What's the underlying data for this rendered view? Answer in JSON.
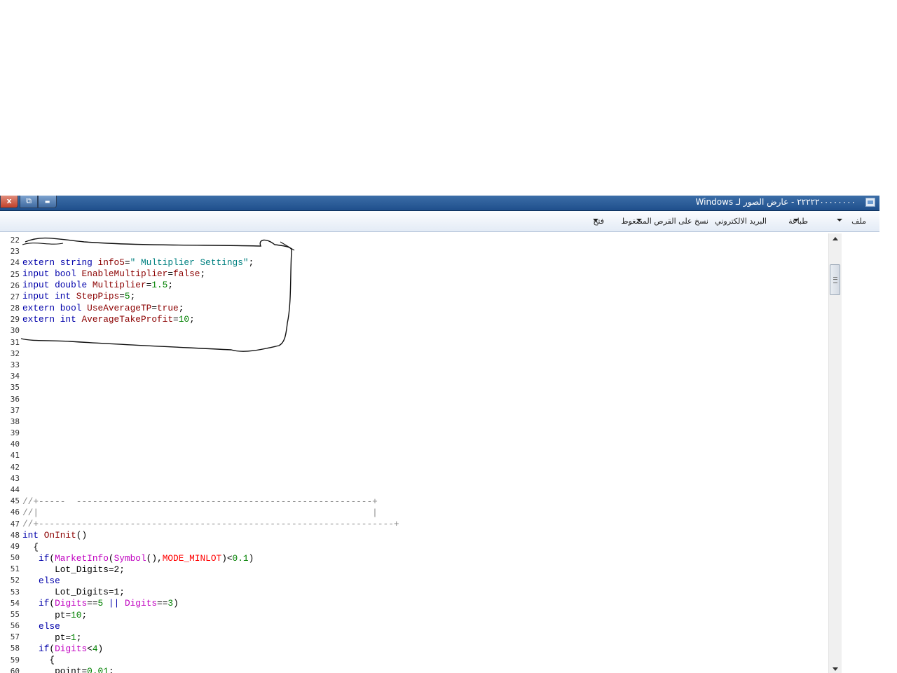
{
  "window": {
    "title": "٢٢٢٢٢٠٠٠٠٠٠٠٠ - عارض الصور لـ Windows",
    "close_glyph": "x",
    "maximize_glyph": "⧉",
    "minimize_glyph": "▬"
  },
  "menu": {
    "file": "ملف",
    "print": "طباعة",
    "email": "البريد الالكتروني",
    "burn": "نسخ على القرص المضغوط",
    "open": "فتح"
  },
  "code": {
    "line_numbers": [
      "22",
      "23",
      "24",
      "25",
      "26",
      "27",
      "28",
      "29",
      "30",
      "31",
      "32",
      "33",
      "34",
      "35",
      "36",
      "37",
      "38",
      "39",
      "40",
      "41",
      "42",
      "43",
      "44",
      "45",
      "46",
      "47",
      "48",
      "49",
      "50",
      "51",
      "52",
      "53",
      "54",
      "55",
      "56",
      "57",
      "58",
      "59",
      "60"
    ],
    "l24": {
      "kw": "extern string ",
      "var": "info5",
      "eq": "=",
      "str": "\" Multiplier Settings\"",
      "end": ";"
    },
    "l25": {
      "kw": "input bool ",
      "var": "EnableMultiplier",
      "eq": "=",
      "val": "false",
      "end": ";"
    },
    "l26": {
      "kw": "input double ",
      "var": "Multiplier",
      "eq": "=",
      "val": "1.5",
      "end": ";"
    },
    "l27": {
      "kw": "input int ",
      "var": "StepPips",
      "eq": "=",
      "val": "5",
      "end": ";"
    },
    "l28": {
      "kw": "extern bool ",
      "var": "UseAverageTP",
      "eq": "=",
      "val": "true",
      "end": ";"
    },
    "l29": {
      "kw": "extern int ",
      "var": "AverageTakeProfit",
      "eq": "=",
      "val": "10",
      "end": ";"
    },
    "l45": "//+-----  -------------------------------------------------------+",
    "l46": "//|                                                              |",
    "l47": "//+------------------------------------------------------------------+",
    "l48": {
      "kw": "int ",
      "fn": "OnInit",
      "rest": "()"
    },
    "l49": "  {",
    "l50": {
      "ind": "   ",
      "kw": "if",
      "p1": "(",
      "fn1": "MarketInfo",
      "p2": "(",
      "fn2": "Symbol",
      "p3": "(),",
      "mc": "MODE_MINLOT",
      "p4": ")<",
      "num": "0.1",
      "p5": ")"
    },
    "l51": "      Lot_Digits=2;",
    "l52": {
      "ind": "   ",
      "kw": "else"
    },
    "l53": "      Lot_Digits=1;",
    "l54": {
      "ind": "   ",
      "kw": "if",
      "p1": "(",
      "d1": "Digits",
      "op1": "==",
      "n1": "5",
      "op2": " || ",
      "d2": "Digits",
      "op3": "==",
      "n2": "3",
      "p2": ")"
    },
    "l55": {
      "ind": "      ",
      "var": "pt",
      "eq": "=",
      "num": "10",
      "end": ";"
    },
    "l56": {
      "ind": "   ",
      "kw": "else"
    },
    "l57": {
      "ind": "      ",
      "var": "pt",
      "eq": "=",
      "num": "1",
      "end": ";"
    },
    "l58": {
      "ind": "   ",
      "kw": "if",
      "p1": "(",
      "d1": "Digits",
      "op1": "<",
      "n1": "4",
      "p2": ")"
    },
    "l59": "     {",
    "l60": {
      "ind": "      ",
      "var": "point",
      "eq": "=",
      "num": "0.01",
      "end": ";"
    }
  },
  "colors": {
    "titlebar": "#2b5c98",
    "keyword": "#0000aa",
    "identifier": "#8b0000",
    "string": "#008080",
    "number": "#008000",
    "predefined": "#c000c0",
    "constant": "#ff0000",
    "comment": "#888888"
  },
  "icons": [
    "close-icon",
    "maximize-icon",
    "minimize-icon",
    "app-icon",
    "dropdown-arrow-icon",
    "scroll-up-icon",
    "scroll-down-icon"
  ]
}
